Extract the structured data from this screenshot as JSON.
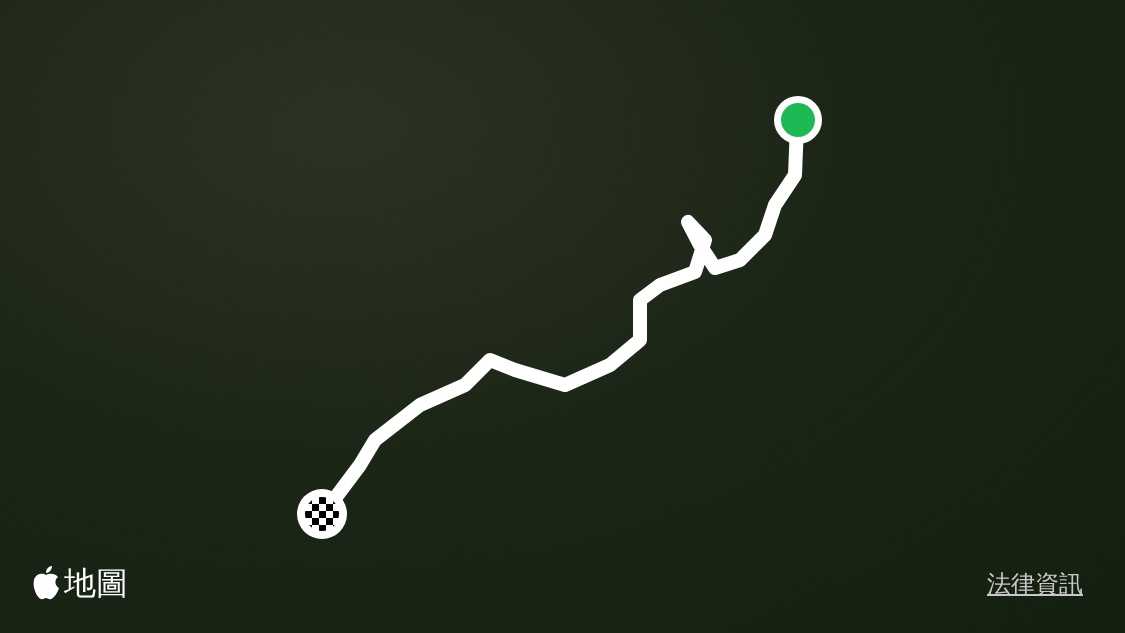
{
  "map": {
    "logo_text": "地圖",
    "legal_link": "法律資訊"
  }
}
